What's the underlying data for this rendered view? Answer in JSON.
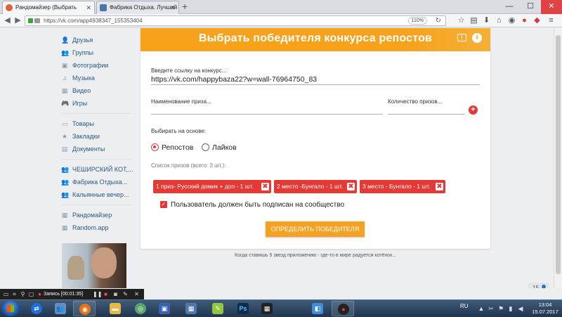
{
  "browser": {
    "tabs": [
      {
        "label": "Рандомайзер (Выбрать",
        "favicon_color": "#e0603a"
      },
      {
        "label": "Фабрика Отдыха. Лучший с",
        "favicon_color": "#4a76a8"
      }
    ],
    "tab_close": "✕",
    "new_tab": "+",
    "url": "https://vk.com/app4938347_155353404",
    "zoom": "110%",
    "window": {
      "minimize": "—",
      "maximize": "☐",
      "close": "✕"
    }
  },
  "sidebar": {
    "items_top": [
      {
        "label": "Друзья",
        "icon": "👤"
      },
      {
        "label": "Группы",
        "icon": "👥"
      },
      {
        "label": "Фотографии",
        "icon": "▣"
      },
      {
        "label": "Музыка",
        "icon": "♫"
      },
      {
        "label": "Видео",
        "icon": "▦"
      },
      {
        "label": "Игры",
        "icon": "🎮"
      }
    ],
    "items_mid": [
      {
        "label": "Товары",
        "icon": "▭"
      },
      {
        "label": "Закладки",
        "icon": "★"
      },
      {
        "label": "Документы",
        "icon": "▤"
      }
    ],
    "items_groups": [
      {
        "label": "ЧЕШИРСКИЙ КОТ,...",
        "icon": "👥"
      },
      {
        "label": "Фабрика Отдыха...",
        "icon": "👥"
      },
      {
        "label": "Кальянные вечер...",
        "icon": "👥"
      }
    ],
    "items_apps": [
      {
        "label": "Рандомайзер",
        "icon": "▦"
      },
      {
        "label": "Random.app",
        "icon": "▦"
      }
    ]
  },
  "app": {
    "title": "Выбрать победителя конкурса репостов",
    "link_label": "Введите ссылку на конкурс...",
    "link_value": "https://vk.com/happybaza22?w=wall-76964750_83",
    "prize_name_placeholder": "Наименование приза...",
    "prize_count_placeholder": "Количество призов...",
    "add_prize": "+",
    "choose_basis_label": "Выбирать на основе:",
    "option_reposts": "Репостов",
    "option_likes": "Лайков",
    "prize_list_label": "Список призов (всего: 3 шт.):",
    "prizes": [
      "1 приз- Русский домик + доп - 1 шт.",
      "2 место -Бунгало - 1 шт.",
      "3 место - Бунгало - 1 шт."
    ],
    "remove_symbol": "✖",
    "subscribe_checkbox": "Пользователь должен быть подписан на сообщество",
    "submit": "ОПРЕДЕЛИТЬ ПОБЕДИТЕЛЯ",
    "footer_note": "Когда ставишь 5 звезд приложению - где-то в мире радуется котёнок..."
  },
  "page": {
    "counter": "15 👤"
  },
  "recorder": {
    "status": "Запись [00:01:35]"
  },
  "taskbar": {
    "lang": "RU",
    "time": "13:04",
    "date": "15.07.2017"
  }
}
